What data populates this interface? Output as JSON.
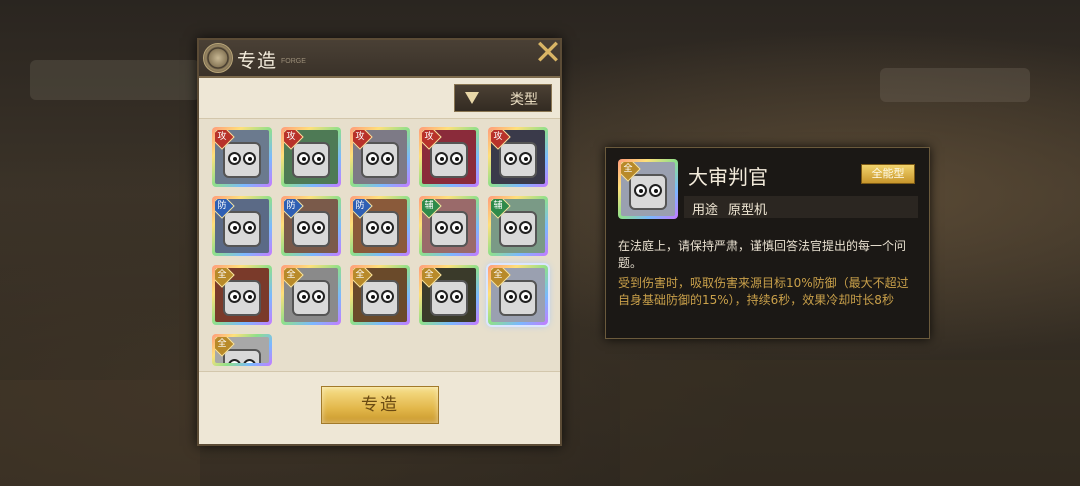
{
  "panel": {
    "title": "专造",
    "subtitle": "FORGE",
    "close": "✕",
    "filter_label": "类型",
    "forge_button": "专造"
  },
  "items": [
    {
      "badge": "攻",
      "badge_color": "#b8322a",
      "bg": "#6b7a8e"
    },
    {
      "badge": "攻",
      "badge_color": "#b8322a",
      "bg": "#4e7a55"
    },
    {
      "badge": "攻",
      "badge_color": "#b8322a",
      "bg": "#7d7a86"
    },
    {
      "badge": "攻",
      "badge_color": "#b8322a",
      "bg": "#8a2b3a"
    },
    {
      "badge": "攻",
      "badge_color": "#b8322a",
      "bg": "#3a3a4a"
    },
    {
      "badge": "防",
      "badge_color": "#2f5fb3",
      "bg": "#5b6a86"
    },
    {
      "badge": "防",
      "badge_color": "#2f5fb3",
      "bg": "#7a5a4a"
    },
    {
      "badge": "防",
      "badge_color": "#2f5fb3",
      "bg": "#8a5a3a"
    },
    {
      "badge": "辅",
      "badge_color": "#2f8a4a",
      "bg": "#9a6a6a"
    },
    {
      "badge": "辅",
      "badge_color": "#2f8a4a",
      "bg": "#7a9a86"
    },
    {
      "badge": "全",
      "badge_color": "#b88a2a",
      "bg": "#7a3a2a"
    },
    {
      "badge": "全",
      "badge_color": "#b88a2a",
      "bg": "#8a8a8a"
    },
    {
      "badge": "全",
      "badge_color": "#b88a2a",
      "bg": "#6a4a2a"
    },
    {
      "badge": "全",
      "badge_color": "#b88a2a",
      "bg": "#3a3a2a"
    },
    {
      "badge": "全",
      "badge_color": "#b88a2a",
      "bg": "#9aa0b0"
    },
    {
      "badge": "全",
      "badge_color": "#b88a2a",
      "bg": "#a8a8a8"
    }
  ],
  "info": {
    "badge": "全",
    "name": "大审判官",
    "type": "全能型",
    "usage_label": "用途",
    "usage_value": "原型机",
    "description": "在法庭上，请保持严肃，谨慎回答法官提出的每一个问题。",
    "effect": "受到伤害时，吸取伤害来源目标10%防御（最大不超过自身基础防御的15%），持续6秒，效果冷却时长8秒"
  }
}
